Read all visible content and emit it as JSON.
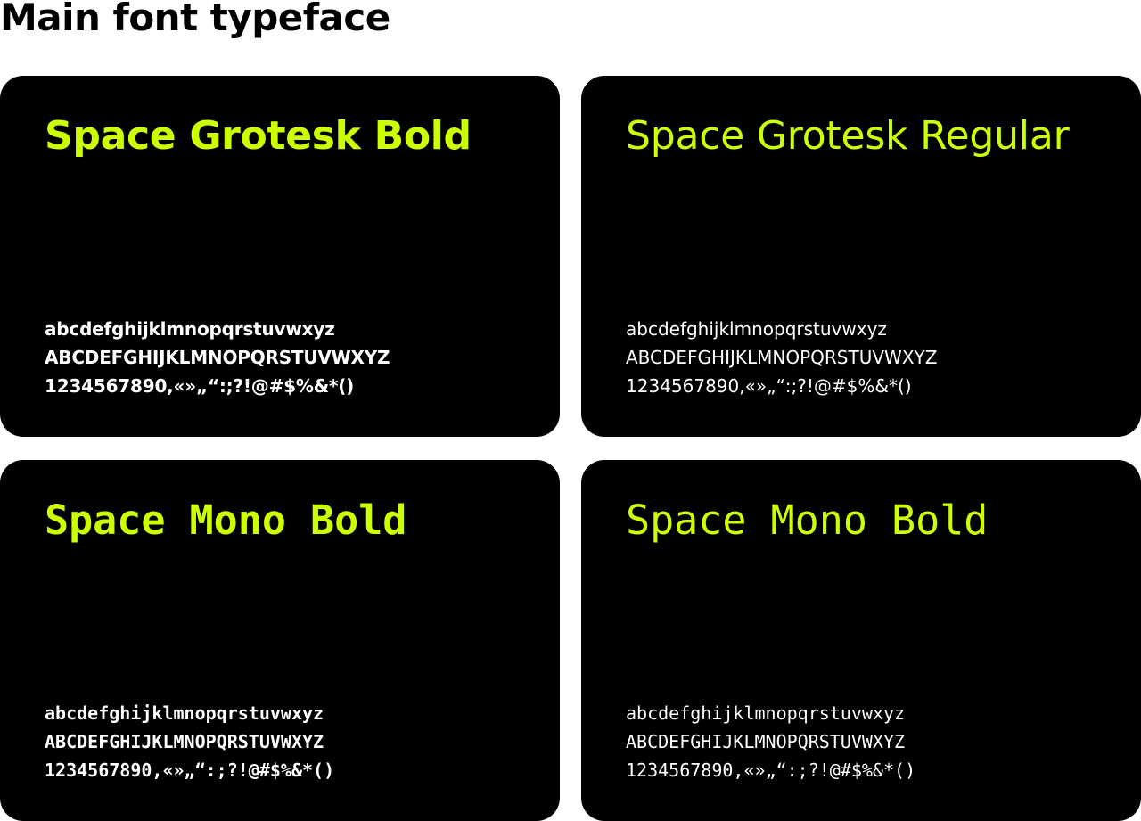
{
  "page": {
    "title": "Main font typeface"
  },
  "colors": {
    "background": "#ffffff",
    "card_background": "#000000",
    "accent": "#ccff00",
    "glyph_text": "#ffffff",
    "title_text": "#000000"
  },
  "cards": [
    {
      "heading": "Space Grotesk Bold",
      "lowercase": "abcdefghijklmnopqrstuvwxyz",
      "uppercase": "ABCDEFGHIJKLMNOPQRSTUVWXYZ",
      "numbers_symbols": "1234567890,«»„“:;?!@#$%&*()"
    },
    {
      "heading": "Space Grotesk Regular",
      "lowercase": "abcdefghijklmnopqrstuvwxyz",
      "uppercase": "ABCDEFGHIJKLMNOPQRSTUVWXYZ",
      "numbers_symbols": "1234567890,«»„“:;?!@#$%&*()"
    },
    {
      "heading": "Space Mono Bold",
      "lowercase": "abcdefghijklmnopqrstuvwxyz",
      "uppercase": "ABCDEFGHIJKLMNOPQRSTUVWXYZ",
      "numbers_symbols": "1234567890,«»„“:;?!@#$%&*()"
    },
    {
      "heading": "Space Mono Bold",
      "lowercase": "abcdefghijklmnopqrstuvwxyz",
      "uppercase": "ABCDEFGHIJKLMNOPQRSTUVWXYZ",
      "numbers_symbols": "1234567890,«»„“:;?!@#$%&*()"
    }
  ]
}
